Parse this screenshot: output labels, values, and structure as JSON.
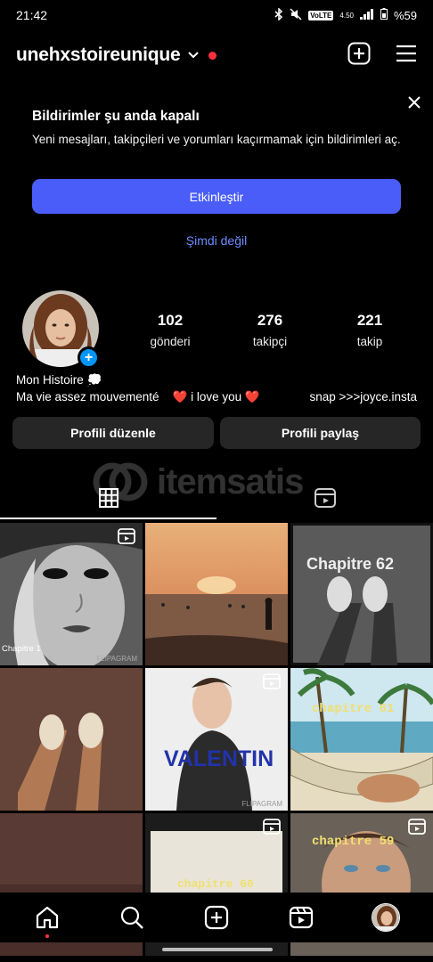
{
  "status_bar": {
    "time": "21:42",
    "battery": "%59",
    "network": "VoLTE",
    "speed": "4.50"
  },
  "header": {
    "username": "unehxstoireunique"
  },
  "notification": {
    "title": "Bildirimler şu anda kapalı",
    "body": "Yeni mesajları, takipçileri ve yorumları kaçırmamak için bildirimleri aç.",
    "button": "Etkinleştir",
    "link": "Şimdi değil"
  },
  "stats": [
    {
      "value": "102",
      "label": "gönderi"
    },
    {
      "value": "276",
      "label": "takipçi"
    },
    {
      "value": "221",
      "label": "takip"
    }
  ],
  "bio": {
    "name": "Mon Histoire 💭",
    "line": "Ma vie assez mouvementé    ❤️ i love you ❤️",
    "snap": "snap >>>joyce.insta"
  },
  "buttons": {
    "edit": "Profili düzenle",
    "share": "Profili paylaş"
  },
  "watermark": "itemsatis",
  "grid": [
    {
      "caption": "Chapitre 1",
      "footer": "FLIPAGRAM",
      "reel": true
    },
    {
      "caption": "",
      "footer": "",
      "reel": false
    },
    {
      "caption": "Chapitre 62",
      "footer": "",
      "reel": false
    },
    {
      "caption": "",
      "footer": "",
      "reel": false
    },
    {
      "caption": "VALENTIN",
      "footer": "FLIPAGRAM",
      "reel": true
    },
    {
      "caption": "chapitre 61",
      "footer": "",
      "reel": false
    },
    {
      "caption": "",
      "footer": "",
      "reel": false
    },
    {
      "caption": "chapitre 60",
      "footer": "",
      "reel": true
    },
    {
      "caption": "chapitre 59",
      "footer": "",
      "reel": true
    }
  ],
  "colors": {
    "accent": "#4a5df9",
    "link": "#6f8cff",
    "notification_dot": "#ff3040",
    "button_bg": "#262626",
    "plus_badge": "#0095f6"
  }
}
